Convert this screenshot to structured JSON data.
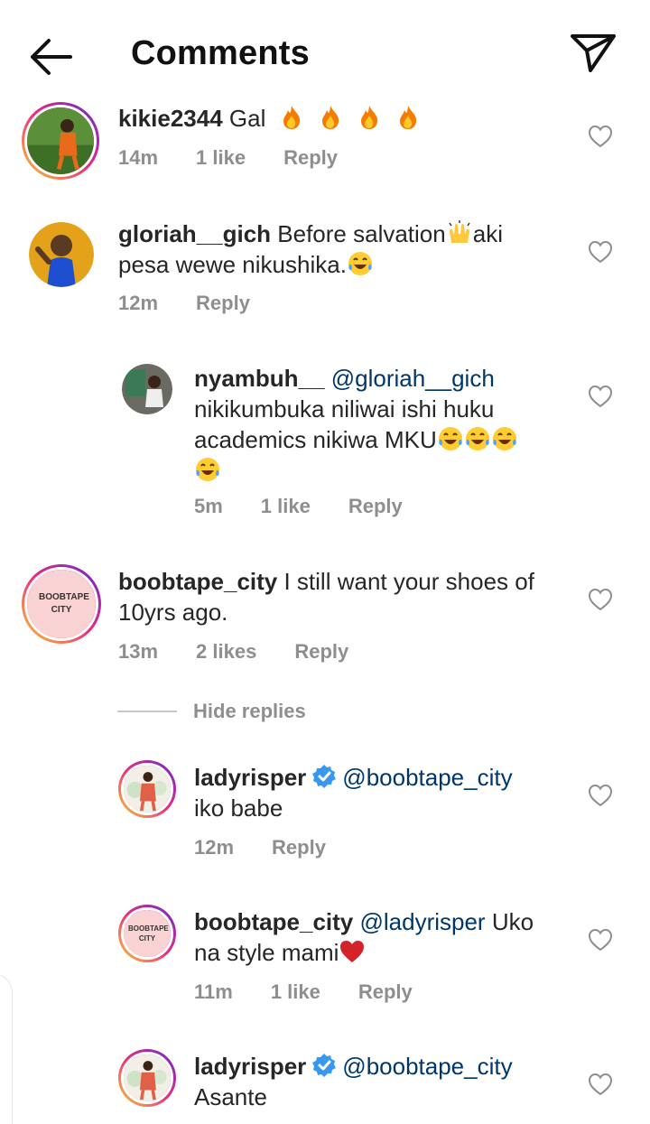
{
  "header": {
    "title": "Comments"
  },
  "comments": [
    {
      "username": "kikie2344",
      "text": "Gal",
      "time": "14m",
      "likes": "1 like",
      "reply": "Reply"
    },
    {
      "username": "gloriah__gich",
      "text_line1": "Before salvation",
      "text_line1b": "aki",
      "text_line2": "pesa wewe nikushika.",
      "time": "12m",
      "reply": "Reply"
    },
    {
      "username": "nyambuh__",
      "mention": "@gloriah__gich",
      "text_line1": "nikikumbuka niliwai ishi huku",
      "text_line2": "academics nikiwa MKU",
      "time": "5m",
      "likes": "1 like",
      "reply": "Reply"
    },
    {
      "username": "boobtape_city",
      "text_line1": "I still want your shoes of",
      "text_line2": "10yrs ago.",
      "time": "13m",
      "likes": "2 likes",
      "reply": "Reply",
      "avatar_text": "BOOBTAPE CITY"
    },
    {
      "username": "ladyrisper",
      "mention": "@boobtape_city",
      "text_line2": "iko babe",
      "time": "12m",
      "reply": "Reply"
    },
    {
      "username": "boobtape_city",
      "mention": "@ladyrisper",
      "text_line1": "Uko",
      "text_line2": "na style mami",
      "time": "11m",
      "likes": "1 like",
      "reply": "Reply",
      "avatar_text": "BOOBTAPE CITY"
    },
    {
      "username": "ladyrisper",
      "mention": "@boobtape_city",
      "text_line2": "Asante"
    }
  ],
  "hide_replies": "Hide replies",
  "icons": {
    "back": "back-arrow-icon",
    "send": "send-icon",
    "heart": "heart-outline-icon",
    "verified": "verified-badge-icon",
    "fire": "fire-emoji",
    "raised_hands": "raised-hands-emoji",
    "laughing": "tears-of-joy-emoji",
    "red_heart": "red-heart-emoji"
  },
  "colors": {
    "text": "#262626",
    "meta": "#8e8e8e",
    "mention": "#00376b",
    "verified": "#3897f0",
    "background": "#ffffff"
  }
}
